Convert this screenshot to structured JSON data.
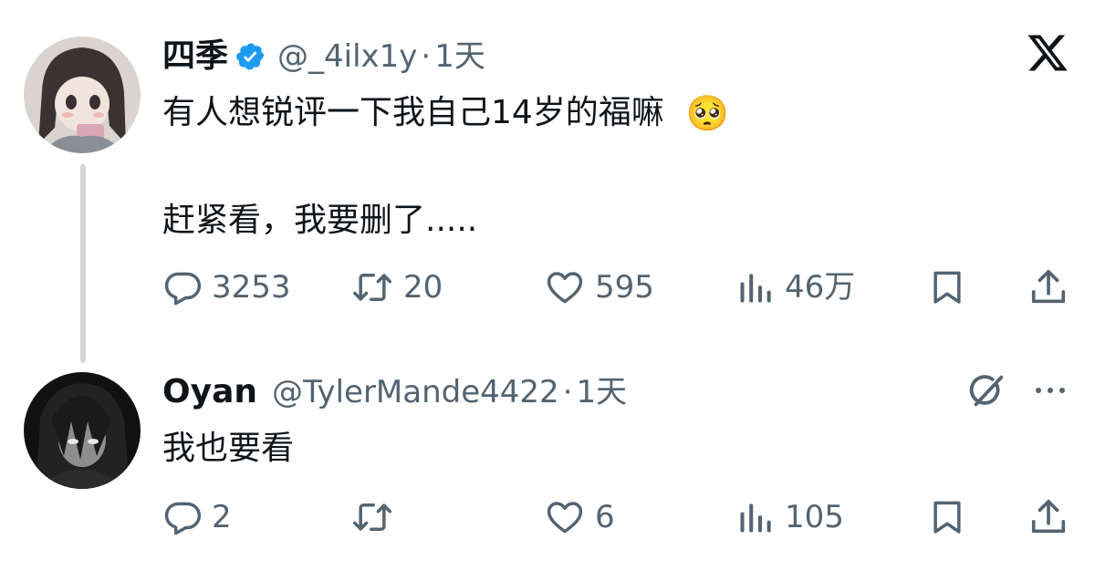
{
  "tweet": {
    "author_name": "四季",
    "handle": "@_4ilx1y",
    "separator": "·",
    "time": "1天",
    "line1": "有人想锐评一下我自己14岁的福嘛",
    "emoji": "🥺",
    "line2": "赶紧看，我要删了.....",
    "replies": "3253",
    "retweets": "20",
    "likes": "595",
    "views": "46万"
  },
  "reply": {
    "author_name": "Oyan",
    "handle": "@TylerMande4422",
    "separator": "·",
    "time": "1天",
    "text": "我也要看",
    "replies": "2",
    "retweets": "",
    "likes": "6",
    "views": "105"
  },
  "colors": {
    "text": "#0f1419",
    "secondary": "#536471",
    "verified": "#1d9bf0",
    "thread_line": "#d0d5da"
  },
  "icons": [
    "x-logo-icon",
    "verified-badge-icon",
    "reply-icon",
    "retweet-icon",
    "like-icon",
    "views-icon",
    "bookmark-icon",
    "share-icon",
    "grok-icon",
    "more-icon"
  ]
}
